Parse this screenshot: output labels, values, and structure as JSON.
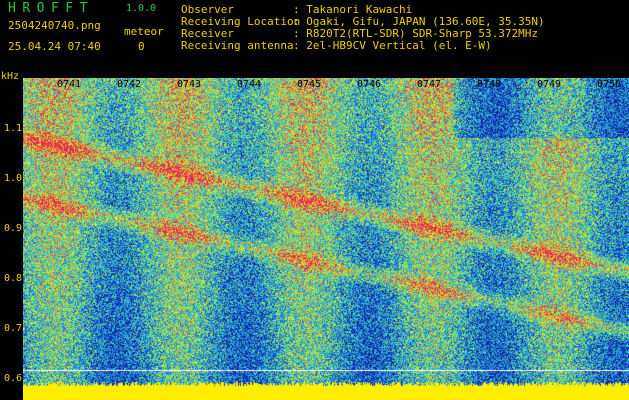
{
  "header": {
    "app_title": "HROFFT",
    "version": "1.0.0",
    "filename": "2504240740.png",
    "datetime": "25.04.24 07:40",
    "meteor_label": "meteor",
    "meteor_count": "0",
    "info": [
      {
        "key": "Observer",
        "value": ": Takanori Kawachi"
      },
      {
        "key": "Receiving Location",
        "value": ": Ogaki, Gifu, JAPAN (136.60E, 35.35N)"
      },
      {
        "key": "Receiver",
        "value": ": R820T2(RTL-SDR) SDR-Sharp 53.372MHz"
      },
      {
        "key": "Receiving antenna",
        "value": ": 2el-HB9CV Vertical (el. E-W)"
      }
    ]
  },
  "axis": {
    "y_unit": "kHz",
    "y_ticks": [
      "1.1",
      "1.0",
      "0.9",
      "0.8",
      "0.7",
      "0.6"
    ],
    "x_ticks": [
      "0741",
      "0742",
      "0743",
      "0744",
      "0745",
      "0746",
      "0747",
      "0748",
      "0749",
      "0750"
    ]
  },
  "colors": {
    "text_yellow": "#f0d000",
    "title_green": "#22cc33",
    "background": "#000000",
    "floor_band": "#ffee00"
  }
}
